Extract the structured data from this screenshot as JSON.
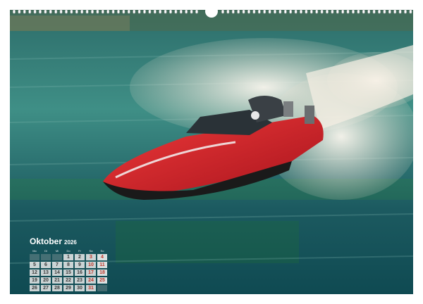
{
  "calendar": {
    "month": "Oktober",
    "year": "2026",
    "weekdays": [
      "Mo",
      "Di",
      "Mi",
      "Do",
      "Fr",
      "Sa",
      "So"
    ],
    "weeks": [
      [
        "",
        "",
        "",
        "1",
        "2",
        "3",
        "4"
      ],
      [
        "5",
        "6",
        "7",
        "8",
        "9",
        "10",
        "11"
      ],
      [
        "12",
        "13",
        "14",
        "15",
        "16",
        "17",
        "18"
      ],
      [
        "19",
        "20",
        "21",
        "22",
        "23",
        "24",
        "25"
      ],
      [
        "26",
        "27",
        "28",
        "29",
        "30",
        "31",
        ""
      ]
    ]
  },
  "colors": {
    "water_dark": "#0f4a52",
    "water_light": "#3f8f86",
    "boat_red": "#d4222c",
    "spray": "#f2ece2",
    "accent_weekend": "#c0392b"
  },
  "icons": [
    "ring-binding-icon",
    "hanger-notch-icon"
  ]
}
